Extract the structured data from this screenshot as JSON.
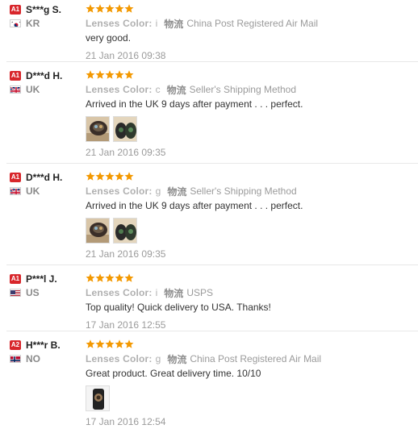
{
  "colors": {
    "star": "#f39800",
    "badge_red": "#d8262b",
    "muted_text": "#9b9b9b",
    "separator": "#e8e8e8"
  },
  "reviews": [
    {
      "badge": "A1",
      "name": "S***g S.",
      "country": "KR",
      "flag_icon": "flag-kr-icon",
      "rating": 5,
      "attr_label": "Lenses Color:",
      "attr_value": "i",
      "ship_label": "物流",
      "ship_value": "China Post Registered Air Mail",
      "text": "very good.",
      "photos": [],
      "date": "21 Jan 2016 09:38"
    },
    {
      "badge": "A1",
      "name": "D***d H.",
      "country": "UK",
      "flag_icon": "flag-uk-icon",
      "rating": 5,
      "attr_label": "Lenses Color:",
      "attr_value": "c",
      "ship_label": "物流",
      "ship_value": "Seller's Shipping Method",
      "text": "Arrived in the UK 9 days after payment . . . perfect.",
      "photos": [
        "photo-lens-case-icon",
        "photo-lenses-icon"
      ],
      "date": "21 Jan 2016 09:35"
    },
    {
      "badge": "A1",
      "name": "D***d H.",
      "country": "UK",
      "flag_icon": "flag-uk-icon",
      "rating": 5,
      "attr_label": "Lenses Color:",
      "attr_value": "g",
      "ship_label": "物流",
      "ship_value": "Seller's Shipping Method",
      "text": "Arrived in the UK 9 days after payment . . . perfect.",
      "photos": [
        "photo-lens-case-icon",
        "photo-lenses-icon"
      ],
      "date": "21 Jan 2016 09:35"
    },
    {
      "badge": "A1",
      "name": "P***l J.",
      "country": "US",
      "flag_icon": "flag-us-icon",
      "rating": 5,
      "attr_label": "Lenses Color:",
      "attr_value": "i",
      "ship_label": "物流",
      "ship_value": "USPS",
      "text": "Top quality! Quick delivery to USA. Thanks!",
      "photos": [],
      "date": "17 Jan 2016 12:55"
    },
    {
      "badge": "A2",
      "name": "H***r B.",
      "country": "NO",
      "flag_icon": "flag-no-icon",
      "rating": 5,
      "attr_label": "Lenses Color:",
      "attr_value": "g",
      "ship_label": "物流",
      "ship_value": "China Post Registered Air Mail",
      "text": "Great product. Great delivery time. 10/10",
      "photos": [
        "photo-product-icon"
      ],
      "date": "17 Jan 2016 12:54"
    }
  ]
}
